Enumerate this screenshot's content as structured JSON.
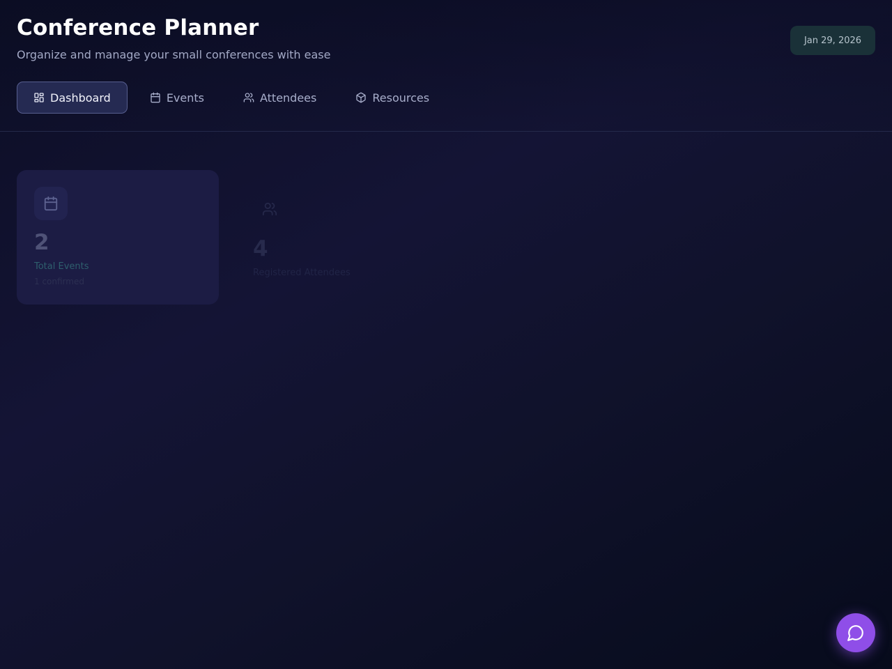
{
  "header": {
    "title": "Conference Planner",
    "subtitle": "Organize and manage your small conferences with ease",
    "date": "Jan 29, 2026"
  },
  "nav": {
    "tabs": [
      {
        "label": "Dashboard",
        "icon": "grid-icon",
        "active": true
      },
      {
        "label": "Events",
        "icon": "calendar-icon",
        "active": false
      },
      {
        "label": "Attendees",
        "icon": "users-icon",
        "active": false
      },
      {
        "label": "Resources",
        "icon": "box-icon",
        "active": false
      }
    ]
  },
  "stats": [
    {
      "value": "2",
      "label": "Total Events",
      "sub": "1 confirmed",
      "icon": "calendar-icon"
    },
    {
      "value": "4",
      "label": "Registered Attendees",
      "icon": "users-icon"
    }
  ],
  "chat": {
    "icon": "chat-bubble-icon"
  },
  "colors": {
    "accent": "#8f4ee8",
    "badge_bg": "#1a3138",
    "active_tab_bg": "#252a52"
  }
}
